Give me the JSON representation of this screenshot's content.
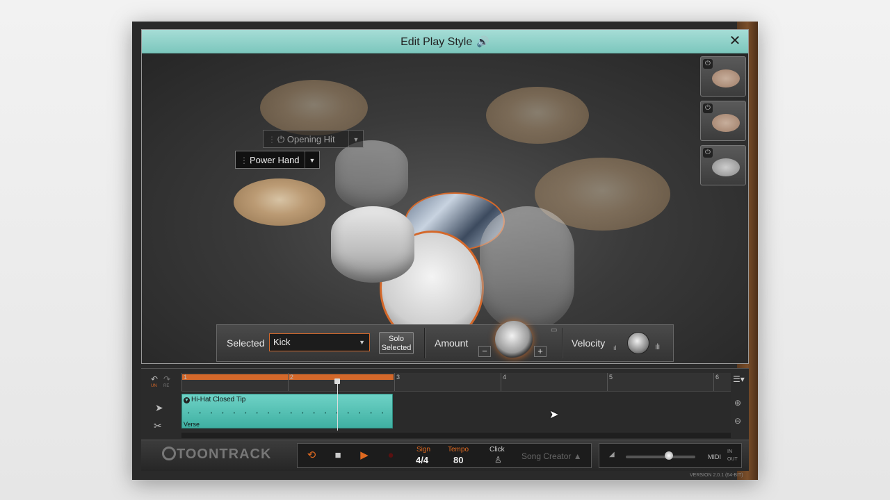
{
  "dialog": {
    "title": "Edit Play Style",
    "speaker_icon": "speaker-icon",
    "close_glyph": "✕"
  },
  "tooltips": {
    "opening_hit": "Opening Hit",
    "power_hand": "Power Hand"
  },
  "controls": {
    "selected_label": "Selected",
    "selected_value": "Kick",
    "solo_line1": "Solo",
    "solo_line2": "Selected",
    "amount_label": "Amount",
    "minus_glyph": "−",
    "plus_glyph": "+",
    "velocity_label": "Velocity"
  },
  "timeline": {
    "undo_label": "UN",
    "redo_label": "RE",
    "bars": [
      "1",
      "2",
      "3",
      "4",
      "5",
      "6"
    ],
    "clip_title": "Hi-Hat Closed Tip",
    "clip_part": "Verse",
    "clip_notes": "• • • • • • • • • • • • • • • • • •"
  },
  "transport": {
    "logo": "TOONTRACK",
    "sign_label": "Sign",
    "sign_value": "4/4",
    "tempo_label": "Tempo",
    "tempo_value": "80",
    "click_label": "Click",
    "song_creator": "Song Creator ▲",
    "midi_label": "MIDI",
    "midi_in": "IN",
    "midi_out": "OUT"
  },
  "version": "VERSION 2.0.1 (64-BIT)",
  "colors": {
    "accent": "#d4682a",
    "titlebar": "#8fd2c9",
    "clip": "#4fbfb1"
  }
}
